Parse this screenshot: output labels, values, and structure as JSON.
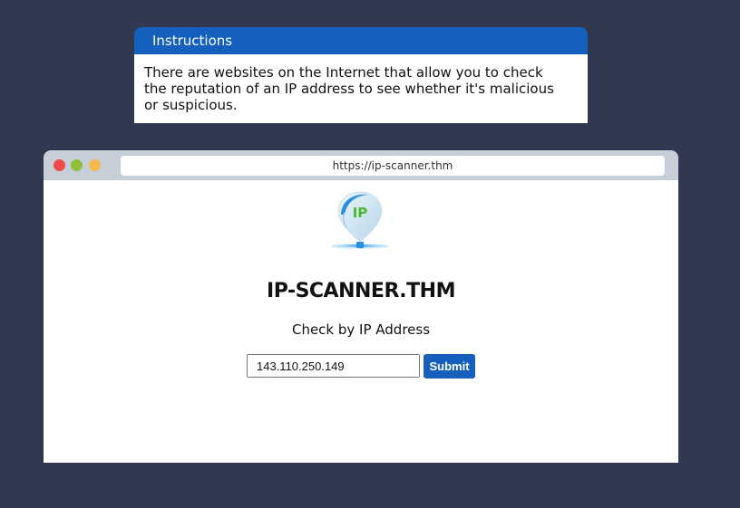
{
  "instructions": {
    "title": "Instructions",
    "text": "There are websites on the Internet that allow you to check the reputation of an IP address to see whether it's malicious or suspicious."
  },
  "browser": {
    "url": "https://ip-scanner.thm",
    "window_controls": [
      "close-dot",
      "minimize-dot",
      "maximize-dot"
    ]
  },
  "page": {
    "logo_text": "IP",
    "title": "IP-SCANNER.THM",
    "subtitle": "Check by IP Address",
    "ip_input_value": "143.110.250.149",
    "submit_label": "Submit"
  },
  "colors": {
    "background": "#303950",
    "accent": "#1560bd",
    "logo_green": "#4cb82e",
    "logo_blue": "#2b8fe0"
  }
}
